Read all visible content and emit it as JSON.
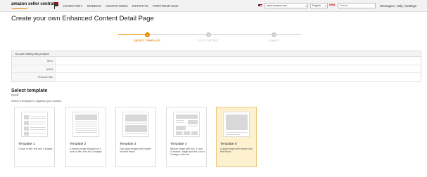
{
  "header": {
    "logo_line1": "amazon seller central",
    "nav": [
      "INVENTORY",
      "ORDERS",
      "ADVERTISING",
      "REPORTS",
      "PERFORMANCE"
    ],
    "marketplace": "www.amazon.com",
    "language": "English",
    "new_badge": "NEW",
    "search_placeholder": "Search",
    "utility_links": "Messages | Help | Settings"
  },
  "page": {
    "title": "Create your own Enhanced Content Detail Page"
  },
  "stepper": {
    "steps": [
      {
        "number": "1",
        "label": "SELECT TEMPLATE",
        "active": true
      },
      {
        "number": "2",
        "label": "EDIT CONTENT",
        "active": false
      },
      {
        "number": "3",
        "label": "SUBMIT",
        "active": false
      }
    ]
  },
  "product": {
    "heading": "You are editing this product:",
    "fields": [
      {
        "label": "SKU",
        "value": ""
      },
      {
        "label": "ASIN",
        "value": ""
      },
      {
        "label": "Product title",
        "value": ""
      }
    ]
  },
  "templates_section": {
    "title": "Select template",
    "status": "Draft",
    "hint": "Select a template to organize your content"
  },
  "templates": [
    {
      "name": "Template 1",
      "description": "4 rows of title, text and 3 images",
      "selected": false
    },
    {
      "name": "Template 2",
      "description": "A banner image followed by 4 rows of title, text and 3 images",
      "selected": false
    },
    {
      "name": "Template 3",
      "description": "Two large images with header and text below",
      "selected": false
    },
    {
      "name": "Template 4",
      "description": "Banner image with text, 2 rows of header, image and text, row of 3 images with text",
      "selected": false
    },
    {
      "name": "Template 5",
      "description": "A large image with header and text below.",
      "selected": true
    }
  ],
  "colors": {
    "accent": "#e68a00",
    "selected_bg": "#fdf1d0"
  }
}
